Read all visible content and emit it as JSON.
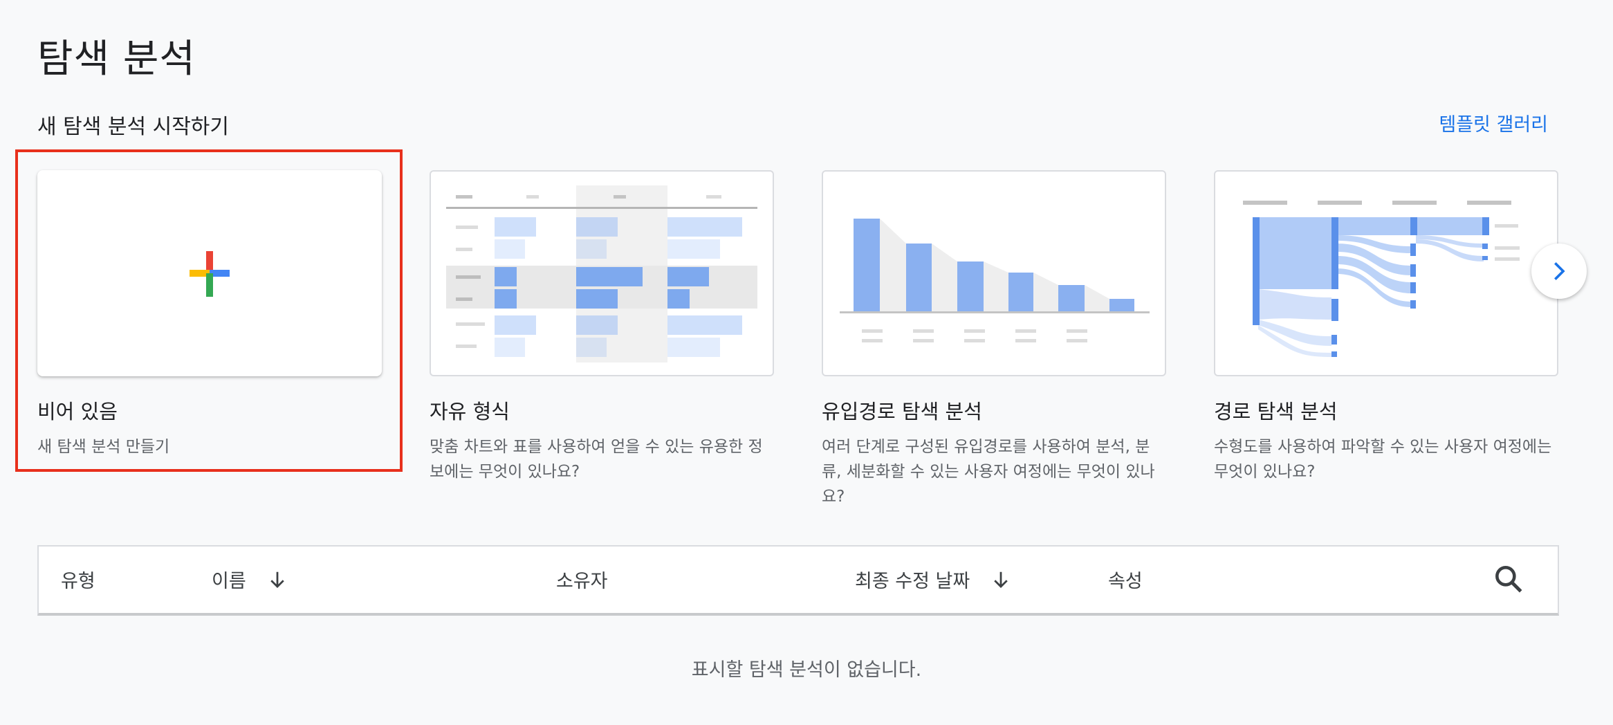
{
  "page": {
    "title": "탐색 분석"
  },
  "new_exploration": {
    "heading": "새 탐색 분석 시작하기",
    "gallery_link": "템플릿 갤러리",
    "cards": [
      {
        "title": "비어 있음",
        "description": "새 탐색 분석 만들기",
        "thumbnail": "plus-icon"
      },
      {
        "title": "자유 형식",
        "description": "맞춤 차트와 표를 사용하여 얻을 수 있는 유용한 정보에는 무엇이 있나요?",
        "thumbnail": "table-illustration"
      },
      {
        "title": "유입경로 탐색 분석",
        "description": "여러 단계로 구성된 유입경로를 사용하여 분석, 분류, 세분화할 수 있는 사용자 여정에는 무엇이 있나요?",
        "thumbnail": "funnel-illustration"
      },
      {
        "title": "경로 탐색 분석",
        "description": "수형도를 사용하여 파악할 수 있는 사용자 여정에는 무엇이 있나요?",
        "thumbnail": "path-illustration"
      }
    ],
    "next_icon": "chevron-right-icon"
  },
  "table": {
    "columns": {
      "type": "유형",
      "name": "이름",
      "owner": "소유자",
      "modified": "최종 수정 날짜",
      "property": "속성"
    },
    "sort_icon": "arrow-down-icon",
    "search_icon": "search-icon",
    "empty_message": "표시할 탐색 분석이 없습니다."
  },
  "colors": {
    "link": "#1a73e8",
    "selection": "#e8301c",
    "plus_red": "#ea4335",
    "plus_blue": "#4285f4",
    "plus_green": "#34a853",
    "plus_yellow": "#fbbc04"
  }
}
